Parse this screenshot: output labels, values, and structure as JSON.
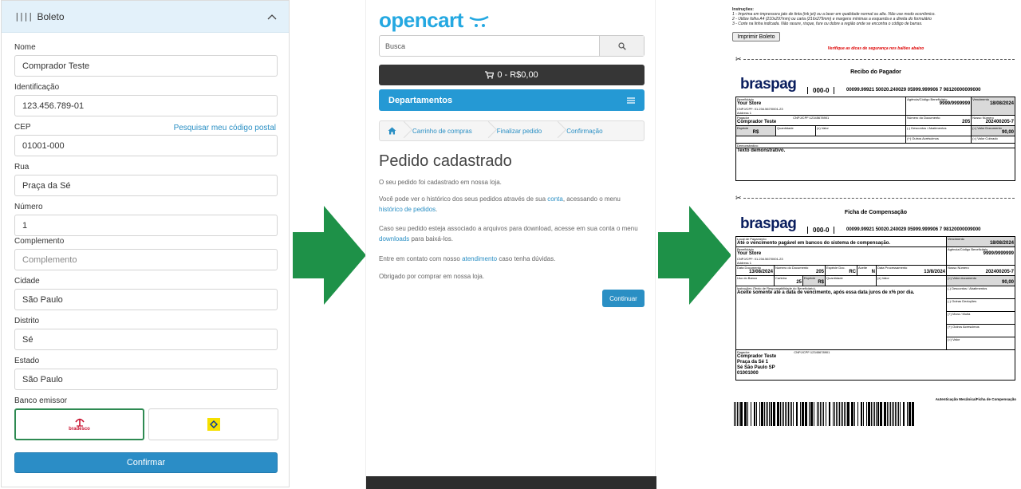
{
  "form": {
    "header_title": "Boleto",
    "fields": [
      {
        "label": "Nome",
        "value": "Comprador Teste"
      },
      {
        "label": "Identificação",
        "value": "123.456.789-01"
      },
      {
        "label": "CEP",
        "value": "01001-000",
        "link": "Pesquisar meu código postal"
      },
      {
        "label": "Rua",
        "value": "Praça da Sé"
      },
      {
        "label": "Número",
        "value": "1"
      },
      {
        "label": "Complemento",
        "value": "",
        "placeholder": "Complemento"
      },
      {
        "label": "Cidade",
        "value": "São Paulo"
      },
      {
        "label": "Distrito",
        "value": "Sé"
      },
      {
        "label": "Estado",
        "value": "São Paulo"
      }
    ],
    "bank_label": "Banco emissor",
    "banks": [
      {
        "name": "bradesco",
        "selected": true
      },
      {
        "name": "Banco do Brasil",
        "selected": false
      }
    ],
    "confirm_label": "Confirmar"
  },
  "colors": {
    "accent": "#2b8dc6",
    "arrow": "#1e9148",
    "header_bg": "#e3f1fa",
    "selected_border": "#2e8a52"
  },
  "store": {
    "logo": "opencart",
    "search_placeholder": "Busca",
    "cart_label": "0 - R$0,00",
    "menu_label": "Departamentos",
    "breadcrumbs": [
      "Carrinho de compras",
      "Finalizar pedido",
      "Confirmação"
    ],
    "heading": "Pedido cadastrado",
    "p1": "O seu pedido foi cadastrado em nossa loja.",
    "p2a": "Você pode ver o histórico dos seus pedidos através de sua ",
    "p2_link1": "conta",
    "p2b": ", acessando o menu ",
    "p2_link2": "histórico de pedidos",
    "p2c": ".",
    "p3a": "Caso seu pedido esteja associado a arquivos para download, acesse em sua conta o menu ",
    "p3_link": "downloads",
    "p3b": " para baixá-los.",
    "p4a": "Entre em contato com nosso ",
    "p4_link": "atendimento",
    "p4b": " caso tenha dúvidas.",
    "p5": "Obrigado por comprar em nossa loja.",
    "continue_label": "Continuar"
  },
  "boleto": {
    "instr_title": "Instruções:",
    "instr_1": "1 - Imprima em impressora jato de tinta (ink jet) ou a laser em qualidade normal ou alta. Não use modo econômico.",
    "instr_2": "2 - Utilize folha A4 (210x297mm) ou carta (216x279mm) e margens mínimas a esquerda e a direita do formulário",
    "instr_3": "3 - Corte na linha indicada. Não rasure, risque, fure ou dobre a região onde se encontra o código de barras.",
    "print_label": "Imprimir Boleto",
    "warning": "Verifique as dicas de segurança nos balões abaixo",
    "receipt_title": "Recibo do Pagador",
    "compensation_title": "Ficha de Compensação",
    "brand": "braspag",
    "bank_code": "000-0",
    "digitable_line": "00099.99921 50020.240029 05999.999906 7 98120000009000",
    "lbl_beneficiario": "Beneficiário",
    "beneficiario": "Your Store",
    "cnpj": "CNPJ/CPF: 01.234.567/0001-23",
    "address": "Address 1",
    "lbl_agencia": "Agência/Código Beneficiário",
    "agencia": "9999/9999999",
    "lbl_vencimento": "Vencimento",
    "vencimento": "18/08/2024",
    "lbl_pagador": "Pagador",
    "pagador_cpf": "CNPJ/CPF:12345678901",
    "pagador": "Comprador Teste",
    "lbl_numero_doc": "Número do Documento",
    "numero_doc": "205",
    "lbl_nosso_numero": "Nosso Número",
    "nosso_numero": "202400205-7",
    "lbl_especie": "Espécie",
    "especie": "R$",
    "lbl_quantidade": "Quantidade",
    "lbl_x_valor": "(x) Valor",
    "lbl_descontos": "(-) Descontos / Abatimentos",
    "lbl_valor_documento_r": "(=) Valor Documento",
    "lbl_valor_documento_c": "(=) Valor documento",
    "valor": "90,00",
    "lbl_acrescimos": "(+) Outros Acréscimos",
    "lbl_valor_cobrado": "(=) Valor Cobrado",
    "lbl_demonstrativo": "Demonstrativo:",
    "demonstrativo": "Texto demonstrativo.",
    "lbl_local": "Local de Pagamento",
    "local": "Até o vencimento pagável em bancos do sistema de compensação.",
    "lbl_data_doc": "Data Documento",
    "data_doc": "13/08/2024",
    "lbl_numero_doc_c": "Numero do Documento",
    "lbl_especie_doc": "Espécie Doc.",
    "especie_doc": "RC",
    "lbl_aceite": "Aceite",
    "aceite": "N",
    "lbl_data_proc": "Data Processamento",
    "data_proc": "13/8/2024",
    "lbl_uso_banco": "Uso do Banco",
    "lbl_carteira": "Carteira",
    "carteira": "25",
    "lbl_especie_c": "Espécie",
    "lbl_instrucoes": "Instruções (Texto de Responsabilidade do Beneficiário)",
    "instrucoes": "Aceite somente até a data de vencimento, após essa data juros de x% por dia.",
    "lbl_outras_deducoes": "(-) Outras Deduções",
    "lbl_mora": "(+) Mora / Multa",
    "lbl_outros_acrescimos": "(+) Outros Acrescimos",
    "lbl_valor_c": "(=) Valor",
    "lbl_pagador_c": "Pagador:",
    "pagador_endereco": "Praça da Sé 1",
    "pagador_cidade": "Sé  São Paulo  SP",
    "pagador_cep": "01001000",
    "autenticacao": "Autenticação Mecânica/Ficha de Compensação"
  }
}
